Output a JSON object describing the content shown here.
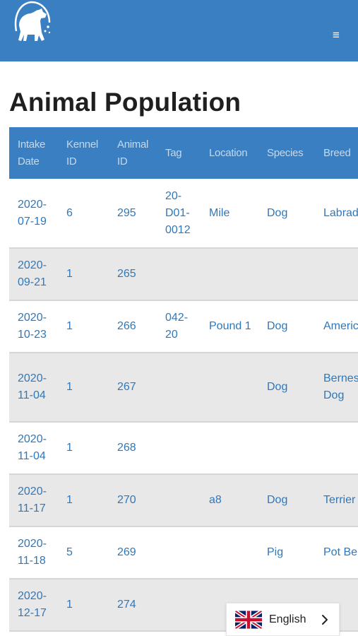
{
  "header": {
    "logo": "dog-logo-icon",
    "menu_icon": "hamburger-icon",
    "menu_glyph": "≡",
    "background_color": "#3a7fc1"
  },
  "page_title": "Animal Population",
  "table": {
    "columns": [
      "Intake Date",
      "Kennel ID",
      "Animal ID",
      "Tag",
      "Location",
      "Species",
      "Breed"
    ],
    "rows": [
      {
        "intake_date": "2020-07-19",
        "kennel_id": "6",
        "animal_id": "295",
        "tag": "20-D01-0012",
        "location": "Mile",
        "species": "Dog",
        "breed": "Labrad"
      },
      {
        "intake_date": "2020-09-21",
        "kennel_id": "1",
        "animal_id": "265",
        "tag": "",
        "location": "",
        "species": "",
        "breed": ""
      },
      {
        "intake_date": "2020-10-23",
        "kennel_id": "1",
        "animal_id": "266",
        "tag": "042-20",
        "location": "Pound 1",
        "species": "Dog",
        "breed": "Americ Bulldo"
      },
      {
        "intake_date": "2020-11-04",
        "kennel_id": "1",
        "animal_id": "267",
        "tag": "",
        "location": "",
        "species": "Dog",
        "breed": "Bernes Mount Dog"
      },
      {
        "intake_date": "2020-11-04",
        "kennel_id": "1",
        "animal_id": "268",
        "tag": "",
        "location": "",
        "species": "",
        "breed": ""
      },
      {
        "intake_date": "2020-11-17",
        "kennel_id": "1",
        "animal_id": "270",
        "tag": "",
        "location": "a8",
        "species": "Dog",
        "breed": "Terrier"
      },
      {
        "intake_date": "2020-11-18",
        "kennel_id": "5",
        "animal_id": "269",
        "tag": "",
        "location": "",
        "species": "Pig",
        "breed": "Pot Be"
      },
      {
        "intake_date": "2020-12-17",
        "kennel_id": "1",
        "animal_id": "274",
        "tag": "",
        "location": "",
        "species": "",
        "breed": ""
      }
    ]
  },
  "language_selector": {
    "label": "English",
    "flag_icon": "uk-flag-icon",
    "chevron_icon": "chevron-right-icon"
  },
  "colors": {
    "header_blue": "#3a7fc1",
    "link_blue": "#2d78bd",
    "header_text": "#c5d9ee",
    "row_alt": "#e8e8e8"
  }
}
